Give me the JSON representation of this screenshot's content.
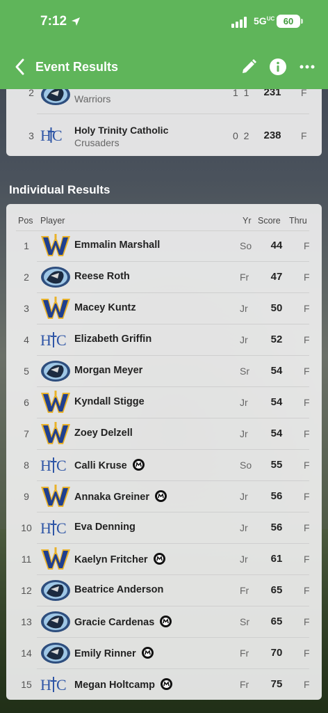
{
  "status_bar": {
    "time": "7:12",
    "network": "5G",
    "network_suffix": "UC",
    "battery": "60"
  },
  "nav": {
    "title": "Event Results"
  },
  "team_results": [
    {
      "pos": "2",
      "logo": "warriors",
      "name": "",
      "mascot": "Warriors",
      "w": "1",
      "l": "1",
      "score": "231",
      "thru": "F"
    },
    {
      "pos": "3",
      "logo": "htc",
      "name": "Holy Trinity Catholic",
      "mascot": "Crusaders",
      "w": "0",
      "l": "2",
      "score": "238",
      "thru": "F"
    }
  ],
  "individual": {
    "section_title": "Individual Results",
    "headers": {
      "pos": "Pos",
      "player": "Player",
      "yr": "Yr",
      "score": "Score",
      "thru": "Thru"
    },
    "rows": [
      {
        "pos": "1",
        "logo": "w",
        "name": "Emmalin Marshall",
        "badge": false,
        "yr": "So",
        "score": "44",
        "thru": "F"
      },
      {
        "pos": "2",
        "logo": "warriors",
        "name": "Reese Roth",
        "badge": false,
        "yr": "Fr",
        "score": "47",
        "thru": "F"
      },
      {
        "pos": "3",
        "logo": "w",
        "name": "Macey Kuntz",
        "badge": false,
        "yr": "Jr",
        "score": "50",
        "thru": "F"
      },
      {
        "pos": "4",
        "logo": "htc",
        "name": "Elizabeth Griffin",
        "badge": false,
        "yr": "Jr",
        "score": "52",
        "thru": "F"
      },
      {
        "pos": "5",
        "logo": "warriors",
        "name": "Morgan Meyer",
        "badge": false,
        "yr": "Sr",
        "score": "54",
        "thru": "F"
      },
      {
        "pos": "6",
        "logo": "w",
        "name": "Kyndall Stigge",
        "badge": false,
        "yr": "Jr",
        "score": "54",
        "thru": "F"
      },
      {
        "pos": "7",
        "logo": "w",
        "name": "Zoey Delzell",
        "badge": false,
        "yr": "Jr",
        "score": "54",
        "thru": "F"
      },
      {
        "pos": "8",
        "logo": "htc",
        "name": "Calli Kruse",
        "badge": true,
        "yr": "So",
        "score": "55",
        "thru": "F"
      },
      {
        "pos": "9",
        "logo": "w",
        "name": "Annaka Greiner",
        "badge": true,
        "yr": "Jr",
        "score": "56",
        "thru": "F"
      },
      {
        "pos": "10",
        "logo": "htc",
        "name": "Eva Denning",
        "badge": false,
        "yr": "Jr",
        "score": "56",
        "thru": "F"
      },
      {
        "pos": "11",
        "logo": "w",
        "name": "Kaelyn Fritcher",
        "badge": true,
        "yr": "Jr",
        "score": "61",
        "thru": "F"
      },
      {
        "pos": "12",
        "logo": "warriors",
        "name": "Beatrice Anderson",
        "badge": false,
        "yr": "Fr",
        "score": "65",
        "thru": "F"
      },
      {
        "pos": "13",
        "logo": "warriors",
        "name": "Gracie Cardenas",
        "badge": true,
        "yr": "Sr",
        "score": "65",
        "thru": "F"
      },
      {
        "pos": "14",
        "logo": "warriors",
        "name": "Emily Rinner",
        "badge": true,
        "yr": "Fr",
        "score": "70",
        "thru": "F"
      },
      {
        "pos": "15",
        "logo": "htc",
        "name": "Megan Holtcamp",
        "badge": true,
        "yr": "Fr",
        "score": "75",
        "thru": "F"
      }
    ]
  },
  "colors": {
    "header": "#5fb55a",
    "w_blue": "#1f3f8f",
    "w_gold": "#e9b22a",
    "htc_blue": "#2e55a6",
    "warriors_blue": "#2e4e7e"
  }
}
